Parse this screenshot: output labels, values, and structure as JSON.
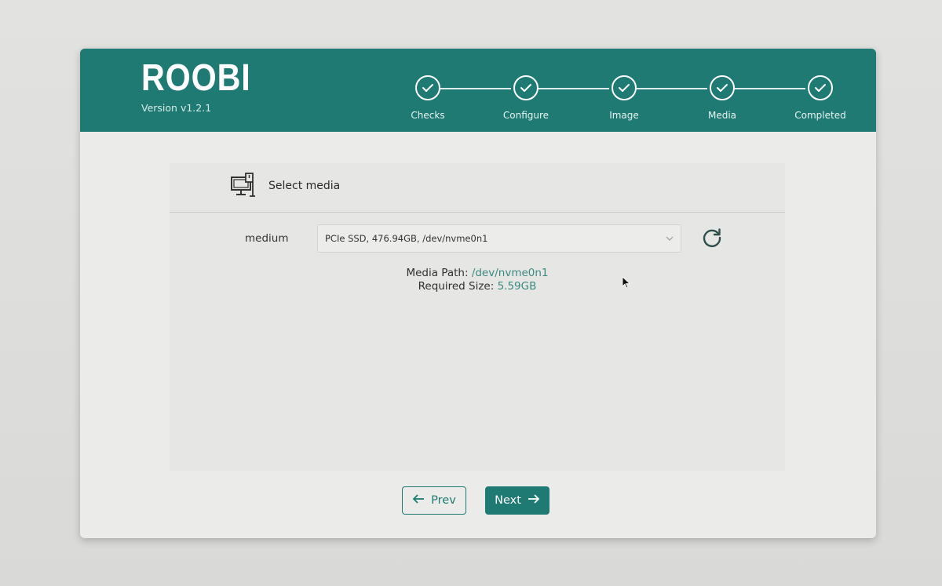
{
  "app": {
    "title": "ROOBI",
    "version": "Version v1.2.1"
  },
  "stepper": {
    "steps": [
      {
        "label": "Checks",
        "status": "completed"
      },
      {
        "label": "Configure",
        "status": "completed"
      },
      {
        "label": "Image",
        "status": "completed"
      },
      {
        "label": "Media",
        "status": "completed"
      },
      {
        "label": "Completed",
        "status": "completed"
      }
    ]
  },
  "panel": {
    "title": "Select media",
    "icon": "media-device-icon"
  },
  "form": {
    "field_label": "medium",
    "selected_value": "PCIe SSD, 476.94GB, /dev/nvme0n1"
  },
  "info": {
    "path_label": "Media Path:",
    "path_value": "/dev/nvme0n1",
    "size_label": "Required Size:",
    "size_value": "5.59GB"
  },
  "buttons": {
    "prev": "Prev",
    "next": "Next"
  },
  "colors": {
    "accent": "#1e7a72",
    "value_text": "#3b8a80"
  }
}
